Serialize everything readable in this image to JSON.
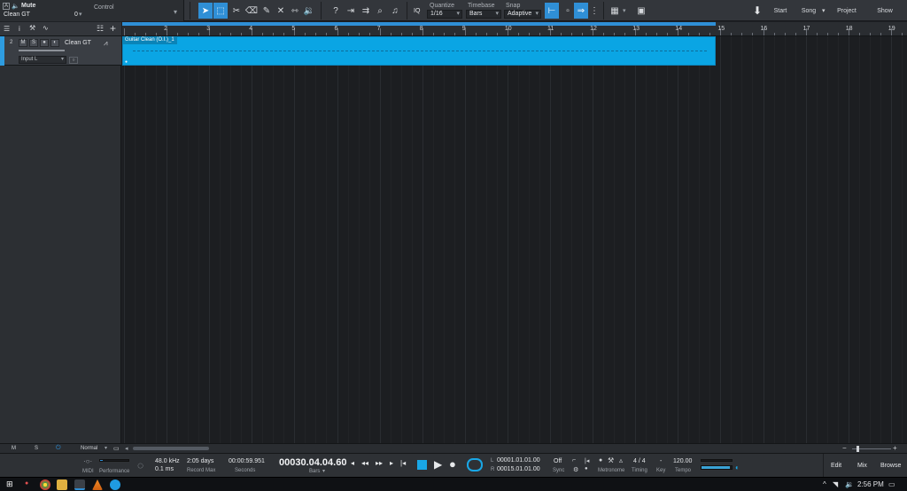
{
  "track_info": {
    "mute_label": "Mute",
    "track_name": "Clean GT",
    "control_label": "Control",
    "control_value": "0"
  },
  "quantize": {
    "label": "Quantize",
    "value": "1/16",
    "iq": "IQ"
  },
  "timebase": {
    "label": "Timebase",
    "value": "Bars"
  },
  "snap": {
    "label": "Snap",
    "value": "Adaptive"
  },
  "nav": {
    "start": "Start",
    "song": "Song",
    "project": "Project",
    "show": "Show"
  },
  "track": {
    "number": "2",
    "mute": "M",
    "solo": "S",
    "name": "Clean GT",
    "input": "Input L"
  },
  "event": {
    "label": "Guitar Clean (O.I.)_1"
  },
  "ruler": {
    "bars": [
      "2",
      "3",
      "4",
      "5",
      "6",
      "7",
      "8",
      "9",
      "10",
      "11",
      "12",
      "13",
      "14",
      "15",
      "16",
      "17",
      "18",
      "19"
    ]
  },
  "footer": {
    "mute_all": "M",
    "solo_all": "S",
    "mode": "Normal"
  },
  "transport": {
    "midi_label": "MIDI",
    "performance_label": "Performance",
    "sample_rate": "48.0 kHz",
    "latency": "0.1 ms",
    "record_max_value": "2:05 days",
    "record_max_label": "Record Max",
    "seconds_value": "00:00:59.951",
    "seconds_label": "Seconds",
    "position": "00030.04.04.60",
    "position_unit": "Bars",
    "loop_start_marker": "L",
    "loop_start": "00001.01.01.00",
    "loop_end_marker": "R",
    "loop_end": "00015.01.01.00",
    "sync_value": "Off",
    "sync_label": "Sync",
    "metronome_label": "Metronome",
    "timing_value": "4 / 4",
    "timing_label": "Timing",
    "key_value": "-",
    "key_label": "Key",
    "tempo_value": "120.00",
    "tempo_label": "Tempo",
    "edit": "Edit",
    "mix": "Mix",
    "browse": "Browse"
  },
  "taskbar": {
    "time": "2:56 PM"
  },
  "colors": {
    "accent": "#2f8fd6",
    "event": "#0aa5e4"
  }
}
